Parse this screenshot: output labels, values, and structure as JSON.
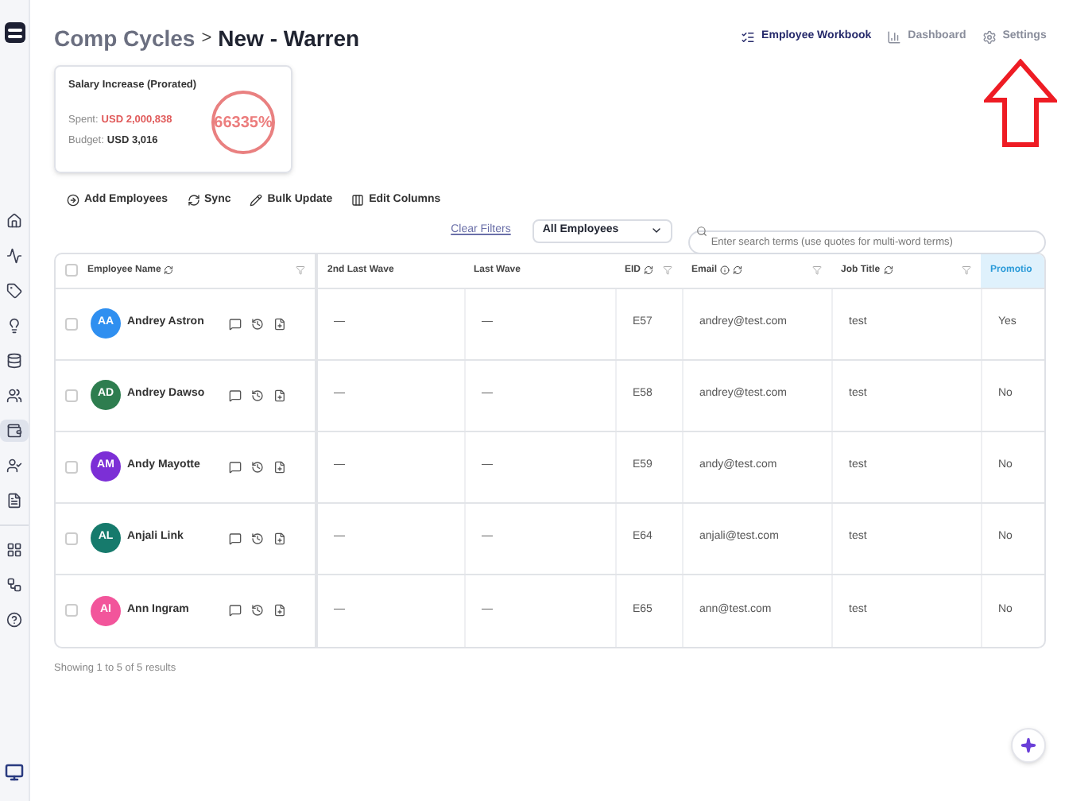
{
  "sidebar": {
    "items": [
      {
        "selected": false
      },
      {
        "selected": false
      },
      {
        "selected": false
      },
      {
        "selected": false
      },
      {
        "selected": false
      },
      {
        "selected": false
      },
      {
        "selected": true
      },
      {
        "selected": false
      },
      {
        "selected": false
      },
      {
        "selected": false
      },
      {
        "selected": false
      },
      {
        "selected": false
      }
    ]
  },
  "breadcrumb": {
    "parent": "Comp Cycles",
    "separator": ">",
    "current": "New - Warren"
  },
  "nav": [
    {
      "label": "Employee Workbook",
      "selected": true
    },
    {
      "label": "Dashboard",
      "selected": false
    },
    {
      "label": "Settings",
      "selected": false
    }
  ],
  "budget_card": {
    "title": "Salary Increase (Prorated)",
    "spent_label": "Spent:",
    "spent": "USD 2,000,838",
    "budget_label": "Budget:",
    "budget": "USD 3,016",
    "percent": "66335%"
  },
  "actions": [
    {
      "label": "Add Employees"
    },
    {
      "label": "Sync"
    },
    {
      "label": "Bulk Update"
    },
    {
      "label": "Edit Columns"
    }
  ],
  "filters": {
    "clear": "Clear Filters",
    "dropdown": "All Employees",
    "search_placeholder": "Enter search terms (use quotes for multi-word terms)"
  },
  "table": {
    "columns": [
      {
        "label": "Employee Name",
        "sync": true,
        "info": false,
        "filter": true,
        "highlighted": false
      },
      {
        "label": "2nd Last Wave",
        "sync": false,
        "info": false,
        "filter": false,
        "highlighted": false
      },
      {
        "label": "Last Wave",
        "sync": false,
        "info": false,
        "filter": false,
        "highlighted": false
      },
      {
        "label": "EID",
        "sync": true,
        "info": false,
        "filter": true,
        "highlighted": false
      },
      {
        "label": "Email",
        "sync": true,
        "info": true,
        "filter": true,
        "highlighted": false
      },
      {
        "label": "Job Title",
        "sync": true,
        "info": false,
        "filter": true,
        "highlighted": false
      },
      {
        "label": "Promotio",
        "sync": false,
        "info": false,
        "filter": false,
        "highlighted": true
      }
    ],
    "rows": [
      {
        "checked": false,
        "initials": "AA",
        "color": "#2f8ff0",
        "name": "Andrey Astron",
        "second_last_wave": "—",
        "last_wave": "—",
        "eid": "E57",
        "email": "andrey@test.com",
        "job_title": "test",
        "promotion": "Yes"
      },
      {
        "checked": false,
        "initials": "AD",
        "color": "#2e7d4f",
        "name": "Andrey Dawso",
        "second_last_wave": "—",
        "last_wave": "—",
        "eid": "E58",
        "email": "andrey@test.com",
        "job_title": "test",
        "promotion": "No"
      },
      {
        "checked": false,
        "initials": "AM",
        "color": "#7c2fd6",
        "name": "Andy Mayotte",
        "second_last_wave": "—",
        "last_wave": "—",
        "eid": "E59",
        "email": "andy@test.com",
        "job_title": "test",
        "promotion": "No"
      },
      {
        "checked": false,
        "initials": "AL",
        "color": "#167a6c",
        "name": "Anjali Link",
        "second_last_wave": "—",
        "last_wave": "—",
        "eid": "E64",
        "email": "anjali@test.com",
        "job_title": "test",
        "promotion": "No"
      },
      {
        "checked": false,
        "initials": "AI",
        "color": "#f2559b",
        "name": "Ann Ingram",
        "second_last_wave": "—",
        "last_wave": "—",
        "eid": "E65",
        "email": "ann@test.com",
        "job_title": "test",
        "promotion": "No"
      }
    ]
  },
  "footer": "Showing 1 to 5 of 5 results"
}
